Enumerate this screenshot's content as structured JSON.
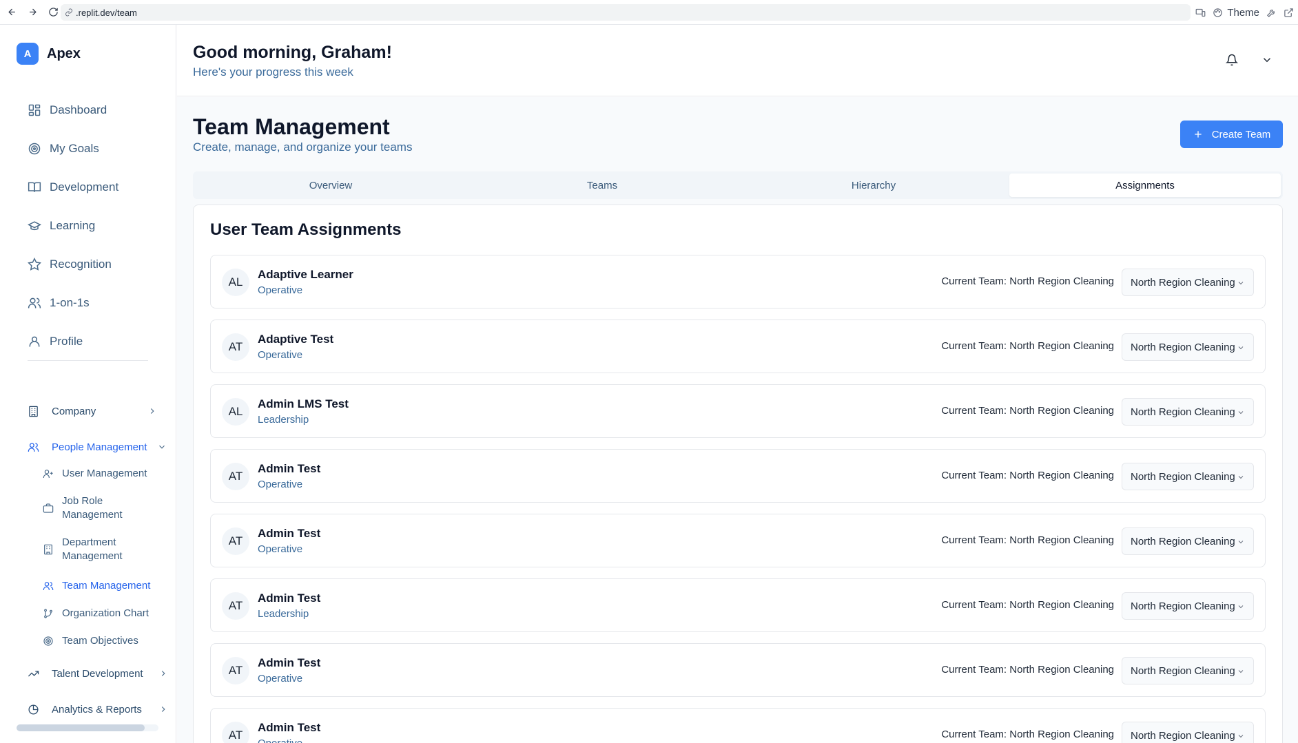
{
  "browser": {
    "url": ".replit.dev/team",
    "theme_label": "Theme"
  },
  "sidebar": {
    "brand_initial": "A",
    "brand_name": "Apex",
    "nav": [
      {
        "label": "Dashboard",
        "icon": "dashboard-icon"
      },
      {
        "label": "My Goals",
        "icon": "target-icon"
      },
      {
        "label": "Development",
        "icon": "book-icon"
      },
      {
        "label": "Learning",
        "icon": "graduation-cap-icon"
      },
      {
        "label": "Recognition",
        "icon": "star-icon"
      },
      {
        "label": "1-on-1s",
        "icon": "users-icon"
      },
      {
        "label": "Profile",
        "icon": "user-icon"
      }
    ],
    "company": "Company",
    "people_management": "People Management",
    "sub_items": [
      {
        "label": "User Management",
        "icon": "user-plus-icon"
      },
      {
        "label": "Job Role Management",
        "icon": "briefcase-icon"
      },
      {
        "label": "Department Management",
        "icon": "building-icon"
      },
      {
        "label": "Team Management",
        "icon": "users-icon"
      },
      {
        "label": "Organization Chart",
        "icon": "git-branch-icon"
      },
      {
        "label": "Team Objectives",
        "icon": "target-icon"
      }
    ],
    "talent_development": "Talent Development",
    "analytics": "Analytics & Reports",
    "active_item": "Team Management"
  },
  "header": {
    "greeting": "Good morning, Graham!",
    "subtitle": "Here's your progress this week"
  },
  "page": {
    "title": "Team Management",
    "subtitle": "Create, manage, and organize your teams",
    "create_button": "Create Team",
    "tabs": [
      "Overview",
      "Teams",
      "Hierarchy",
      "Assignments"
    ],
    "active_tab": "Assignments"
  },
  "assignments": {
    "title": "User Team Assignments",
    "users": [
      {
        "initials": "AL",
        "name": "Adaptive Learner",
        "role": "Operative",
        "current": "Current Team: North Region Cleaning",
        "selected": "North Region Cleaning"
      },
      {
        "initials": "AT",
        "name": "Adaptive Test",
        "role": "Operative",
        "current": "Current Team: North Region Cleaning",
        "selected": "North Region Cleaning"
      },
      {
        "initials": "AL",
        "name": "Admin LMS Test",
        "role": "Leadership",
        "current": "Current Team: North Region Cleaning",
        "selected": "North Region Cleaning"
      },
      {
        "initials": "AT",
        "name": "Admin Test",
        "role": "Operative",
        "current": "Current Team: North Region Cleaning",
        "selected": "North Region Cleaning"
      },
      {
        "initials": "AT",
        "name": "Admin Test",
        "role": "Operative",
        "current": "Current Team: North Region Cleaning",
        "selected": "North Region Cleaning"
      },
      {
        "initials": "AT",
        "name": "Admin Test",
        "role": "Leadership",
        "current": "Current Team: North Region Cleaning",
        "selected": "North Region Cleaning"
      },
      {
        "initials": "AT",
        "name": "Admin Test",
        "role": "Operative",
        "current": "Current Team: North Region Cleaning",
        "selected": "North Region Cleaning"
      },
      {
        "initials": "AT",
        "name": "Admin Test",
        "role": "Operative",
        "current": "Current Team: North Region Cleaning",
        "selected": "North Region Cleaning"
      }
    ]
  },
  "colors": {
    "accent": "#3b82f6",
    "active_link": "#2563eb",
    "muted_text": "#3a6a9a"
  }
}
